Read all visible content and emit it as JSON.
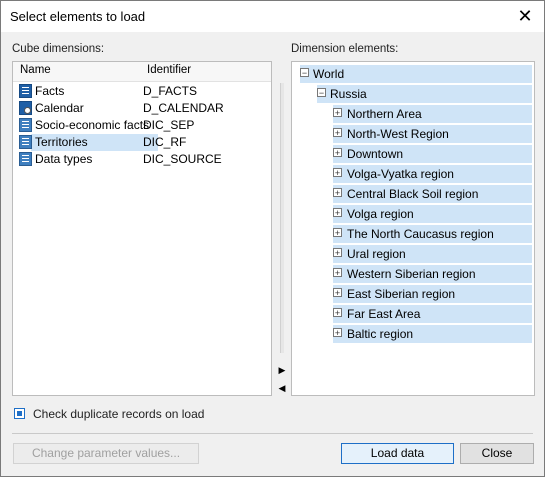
{
  "window": {
    "title": "Select elements to load",
    "close_symbol": "✕"
  },
  "cube_dimensions": {
    "label": "Cube dimensions:",
    "columns": {
      "name": "Name",
      "identifier": "Identifier"
    },
    "rows": [
      {
        "name": "Facts",
        "identifier": "D_FACTS",
        "icon": "cube-icon"
      },
      {
        "name": "Calendar",
        "identifier": "D_CALENDAR",
        "icon": "calendar-icon"
      },
      {
        "name": "Socio-economic facts",
        "identifier": "DIC_SEP",
        "icon": "dictionary-icon"
      },
      {
        "name": "Territories",
        "identifier": "DIC_RF",
        "icon": "dictionary-icon",
        "selected": true
      },
      {
        "name": "Data types",
        "identifier": "DIC_SOURCE",
        "icon": "dictionary-icon"
      }
    ]
  },
  "dimension_elements": {
    "label": "Dimension elements:",
    "root": {
      "name": "World",
      "expanded": true
    },
    "child": {
      "name": "Russia",
      "expanded": true
    },
    "regions": [
      "Northern Area",
      "North-West Region",
      "Downtown",
      "Volga-Vyatka region",
      "Central Black Soil region",
      "Volga region",
      "The North Caucasus region",
      "Ural region",
      "Western Siberian region",
      "East Siberian region",
      "Far East Area",
      "Baltic region"
    ]
  },
  "splitter": {
    "right_arrow": "▶",
    "left_arrow": "◀"
  },
  "options": {
    "check_duplicates_label": "Check duplicate records on load",
    "check_duplicates_checked": true
  },
  "buttons": {
    "change_params": "Change parameter values...",
    "load": "Load data",
    "close": "Close"
  },
  "colors": {
    "selection": "#cfe4f7",
    "accent": "#1e6fc7"
  }
}
